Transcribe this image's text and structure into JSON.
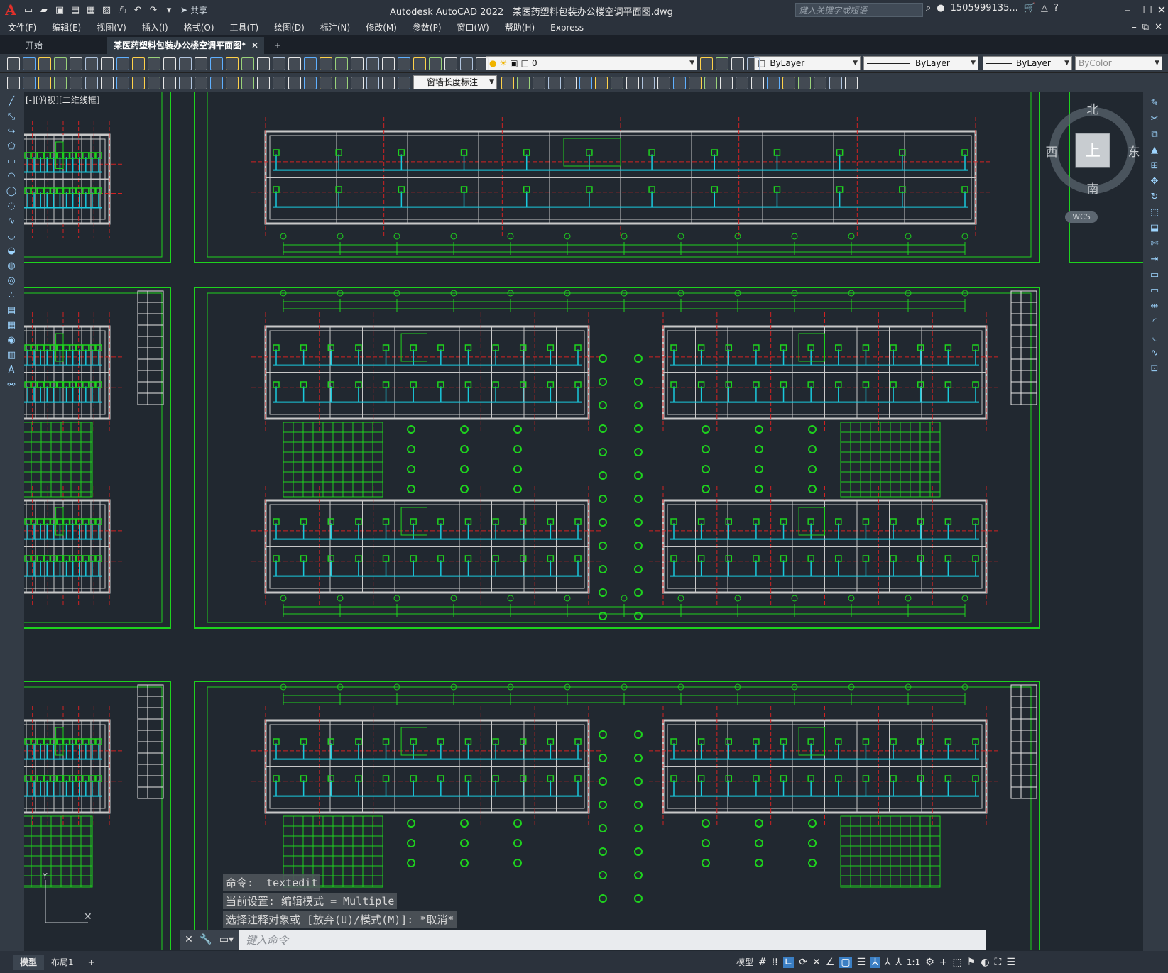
{
  "app": {
    "logo": "A",
    "title": "Autodesk AutoCAD 2022",
    "filename": "某医药塑料包装办公楼空调平面图.dwg",
    "share": "共享",
    "search_placeholder": "键入关键字或短语",
    "user": "1505999135..."
  },
  "menu": [
    "文件(F)",
    "编辑(E)",
    "视图(V)",
    "插入(I)",
    "格式(O)",
    "工具(T)",
    "绘图(D)",
    "标注(N)",
    "修改(M)",
    "参数(P)",
    "窗口(W)",
    "帮助(H)",
    "Express"
  ],
  "tabs": [
    {
      "label": "开始",
      "active": false
    },
    {
      "label": "某医药塑料包装办公楼空调平面图*",
      "active": true
    }
  ],
  "toolbar": {
    "layer": "0",
    "color": "ByLayer",
    "linetype": "ByLayer",
    "lineweight": "ByLayer",
    "plotstyle": "ByColor",
    "dimstyle": "窗墙长度标注"
  },
  "viewport": {
    "label": "[-][俯视][二维线框]",
    "compass": {
      "north": "北",
      "south": "南",
      "east": "东",
      "west": "西",
      "top": "上",
      "wcs": "WCS"
    }
  },
  "command": {
    "history": [
      "命令:  _textedit",
      "当前设置: 编辑模式 = Multiple",
      "选择注释对象或 [放弃(U)/模式(M)]: *取消*"
    ],
    "placeholder": "键入命令"
  },
  "status": {
    "layout_tabs": [
      {
        "label": "模型",
        "active": true
      },
      {
        "label": "布局1",
        "active": false
      }
    ],
    "model_button": "模型",
    "scale": "1:1"
  },
  "colors": {
    "background": "#212830",
    "frame": "#1ed21e",
    "wall": "#c8c8c8",
    "duct": "#19c8dc",
    "axis": "#d22222"
  }
}
